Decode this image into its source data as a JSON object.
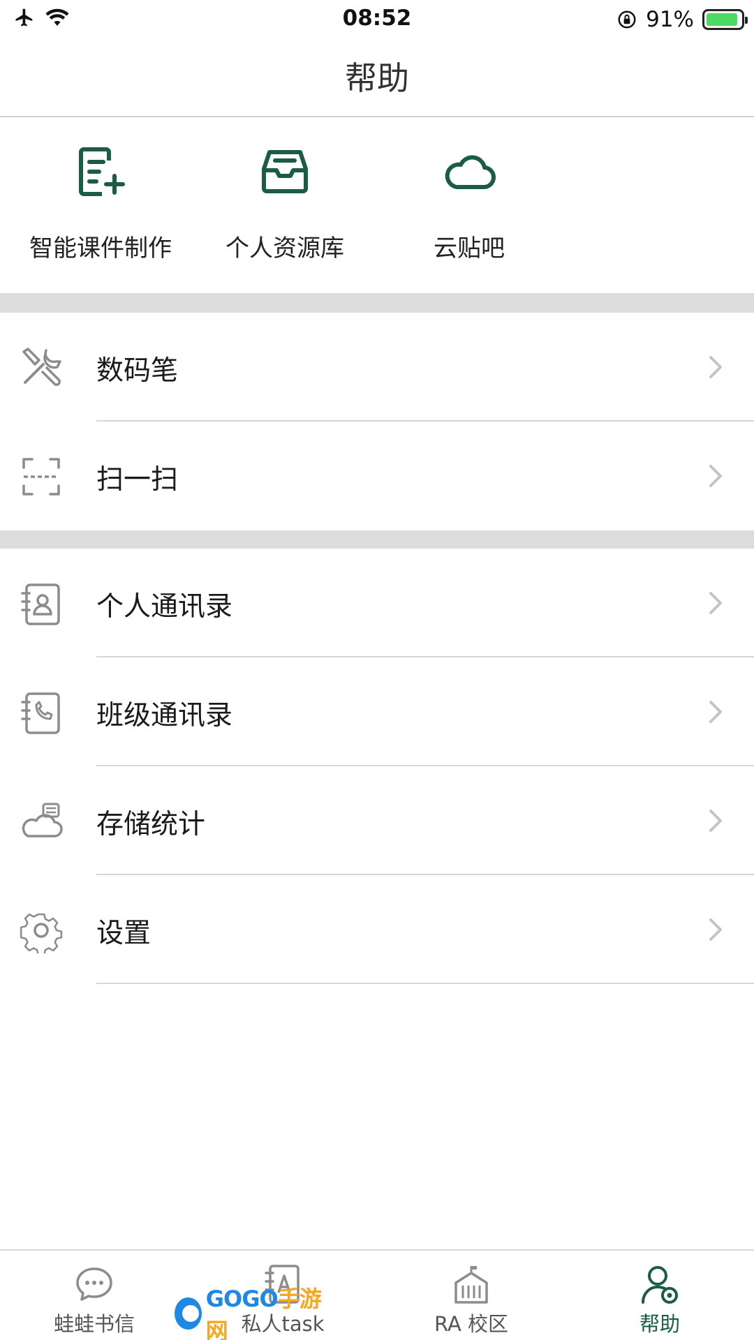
{
  "status_bar": {
    "time": "08:52",
    "battery": "91%",
    "battery_level": 0.91,
    "icons": [
      "airplane-icon",
      "wifi-icon",
      "rotation-lock-icon",
      "battery-icon"
    ]
  },
  "header": {
    "title": "帮助"
  },
  "quick_actions": [
    {
      "label": "智能课件制作",
      "icon": "note-add-icon"
    },
    {
      "label": "个人资源库",
      "icon": "inbox-icon"
    },
    {
      "label": "云贴吧",
      "icon": "cloud-icon"
    }
  ],
  "menu_group_1": [
    {
      "label": "数码笔",
      "icon": "tools-icon"
    },
    {
      "label": "扫一扫",
      "icon": "scan-icon"
    }
  ],
  "menu_group_2": [
    {
      "label": "个人通讯录",
      "icon": "contact-book-icon"
    },
    {
      "label": "班级通讯录",
      "icon": "phone-book-icon"
    },
    {
      "label": "存储统计",
      "icon": "cloud-storage-icon"
    },
    {
      "label": "设置",
      "icon": "gear-icon"
    }
  ],
  "tabbar": [
    {
      "label": "蛙蛙书信",
      "icon": "chat-bubble-icon",
      "active": false
    },
    {
      "label": "私人task",
      "icon": "notebook-icon",
      "active": false
    },
    {
      "label": "RA 校区",
      "icon": "school-building-icon",
      "active": false
    },
    {
      "label": "帮助",
      "icon": "user-settings-icon",
      "active": true
    }
  ],
  "watermark": {
    "text_a": "GOGO",
    "text_b": "手游网"
  },
  "colors": {
    "accent_green": "#1a5c45",
    "gray_icon": "#8c8c8c",
    "separator": "#d6d6d6",
    "section_gap": "#dcdcdc"
  }
}
